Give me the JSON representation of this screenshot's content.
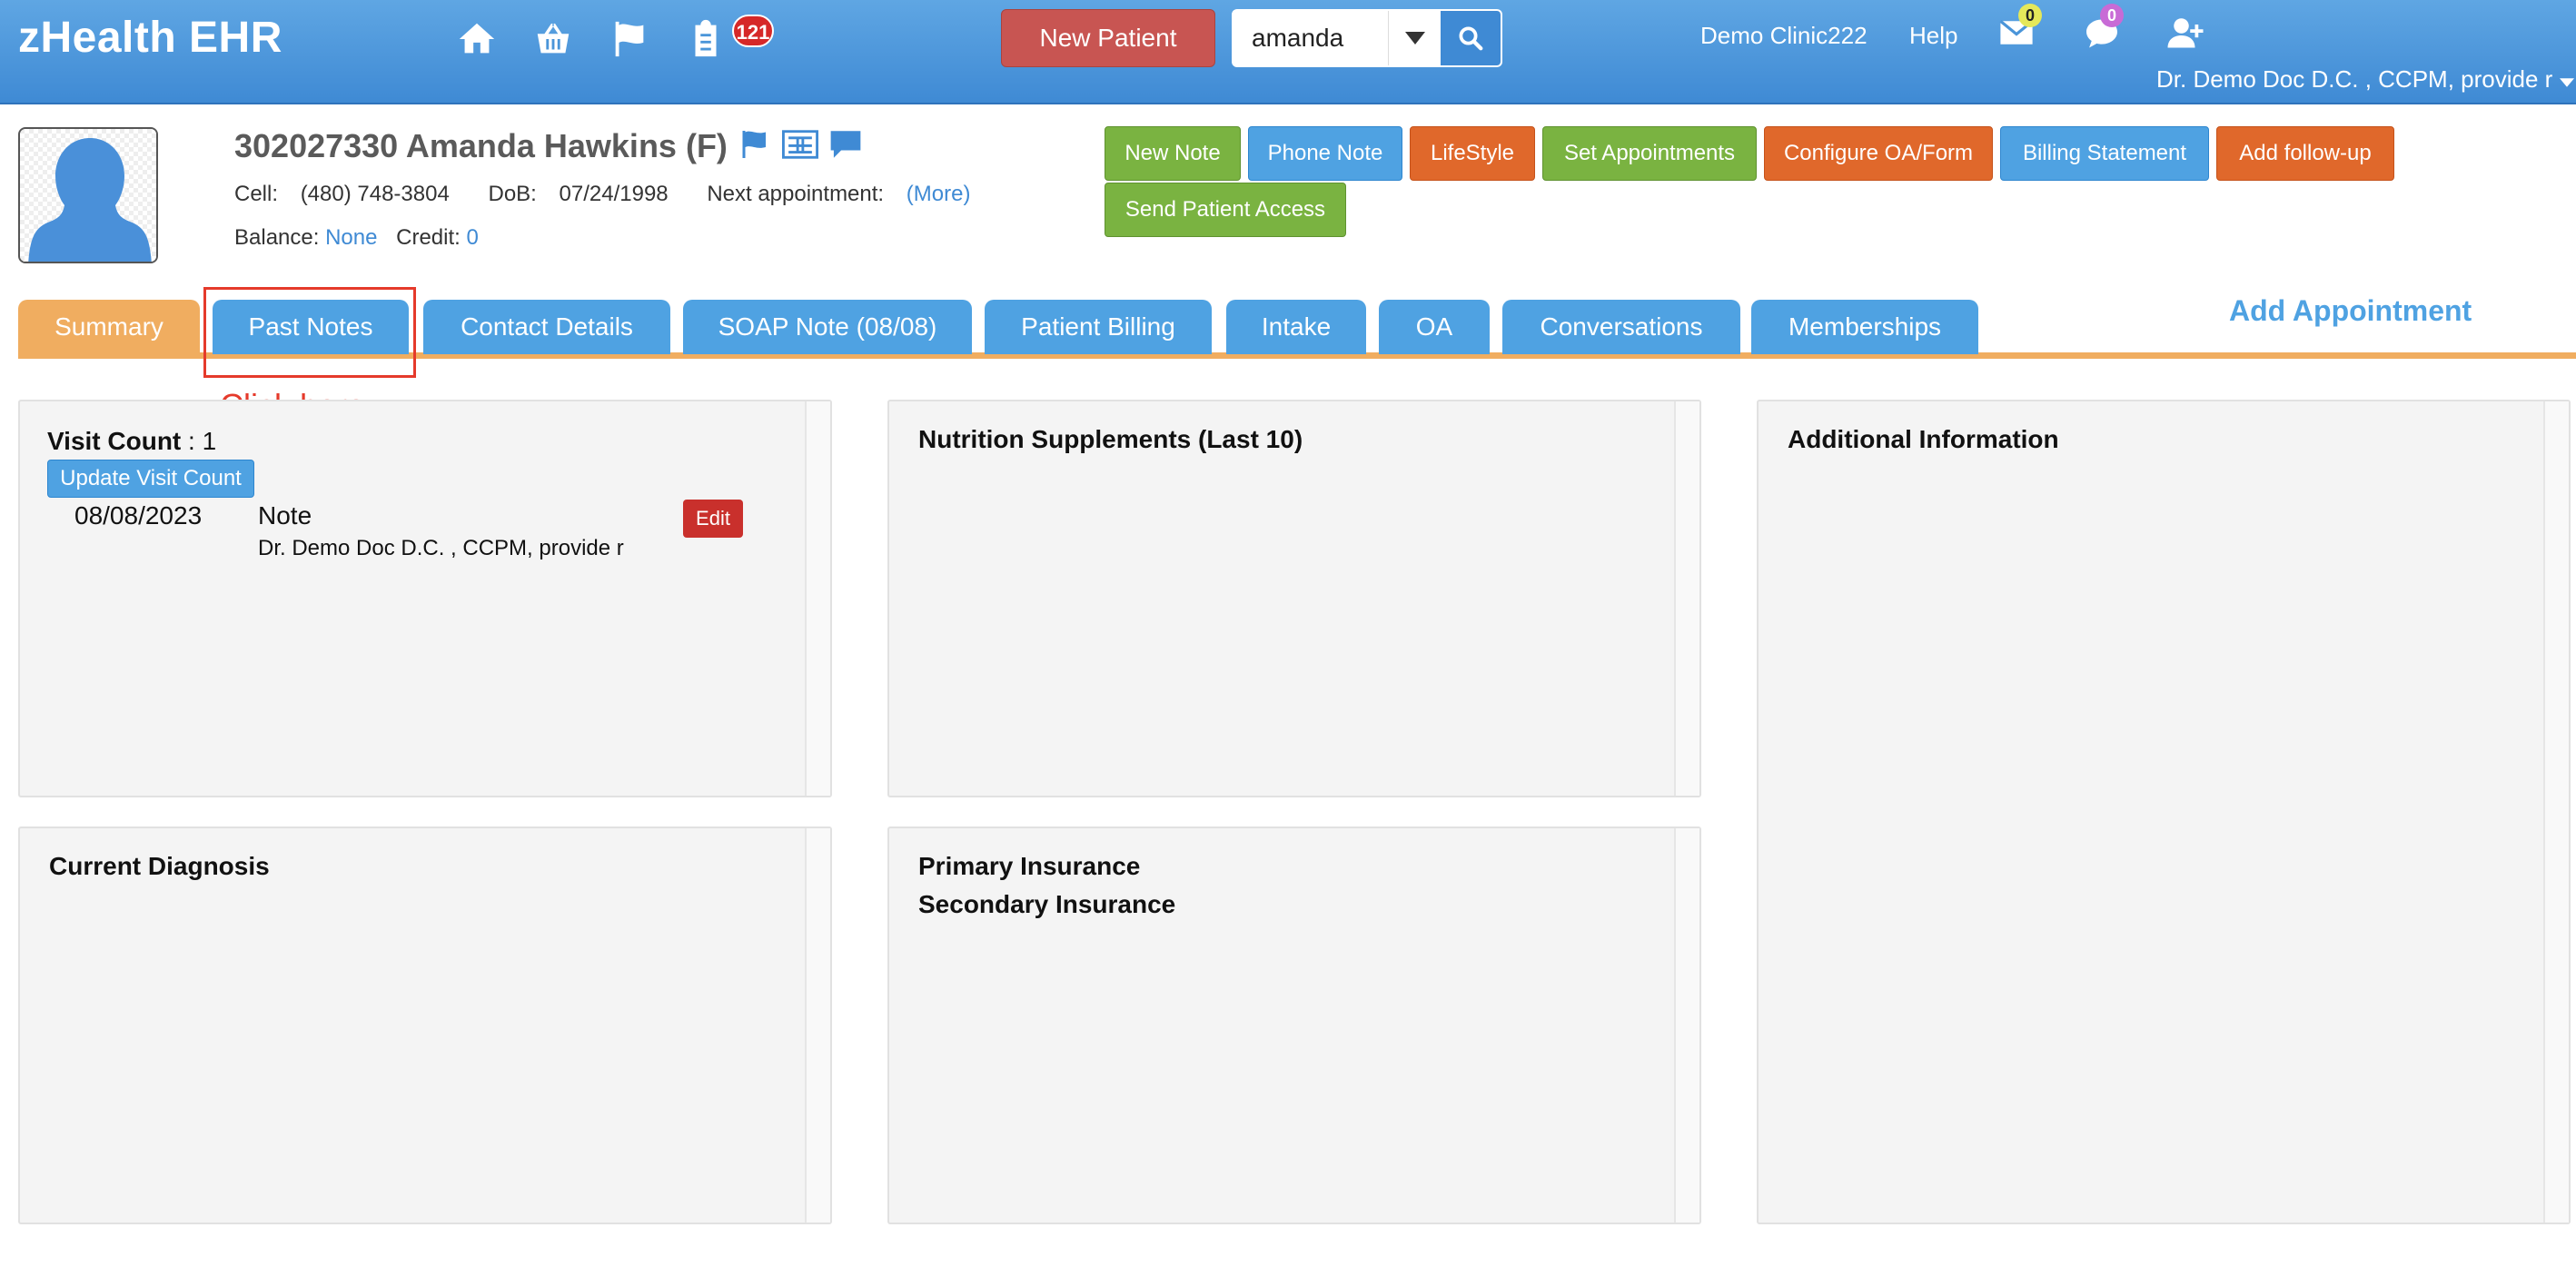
{
  "navbar": {
    "brand": "zHealth EHR",
    "icons": [
      "home-icon",
      "basket-icon",
      "flag-icon",
      "clipboard-icon"
    ],
    "notification_count": "121",
    "new_patient_label": "New Patient",
    "search": {
      "value": "amanda"
    },
    "clinic": "Demo Clinic222",
    "help": "Help",
    "mail_count": "0",
    "chat_count": "0",
    "user": "Dr. Demo Doc D.C. , CCPM, provide r"
  },
  "patient": {
    "title": "302027330 Amanda Hawkins (F)",
    "cell_label": "Cell:",
    "cell": "(480) 748-3804",
    "dob_label": "DoB:",
    "dob": "07/24/1998",
    "next_appt_label": "Next appointment:",
    "more": "(More)",
    "balance_label": "Balance:",
    "balance": "None",
    "credit_label": "Credit:",
    "credit": "0"
  },
  "actions": {
    "new_note": "New Note",
    "phone_note": "Phone Note",
    "lifestyle": "LifeStyle",
    "set_appointments": "Set Appointments",
    "configure": "Configure OA/Form",
    "billing": "Billing Statement",
    "follow_up": "Add follow-up",
    "send_access": "Send Patient Access"
  },
  "tabs": {
    "summary": "Summary",
    "past_notes": "Past Notes",
    "contact": "Contact Details",
    "soap": "SOAP Note (08/08)",
    "billing": "Patient Billing",
    "intake": "Intake",
    "oa": "OA",
    "conversations": "Conversations",
    "memberships": "Memberships",
    "add_appointment": "Add Appointment",
    "annotation": "Click here"
  },
  "visits": {
    "label": "Visit Count",
    "sep": " : ",
    "count": "1",
    "update_label": "Update Visit Count",
    "note": {
      "date": "08/08/2023",
      "title": "Note",
      "author": "Dr. Demo Doc D.C. , CCPM, provide r",
      "edit": "Edit"
    }
  },
  "panels": {
    "nutrition": "Nutrition Supplements (Last 10)",
    "additional": "Additional Information",
    "diagnosis": "Current Diagnosis",
    "primary_ins": "Primary Insurance",
    "secondary_ins": "Secondary Insurance"
  }
}
